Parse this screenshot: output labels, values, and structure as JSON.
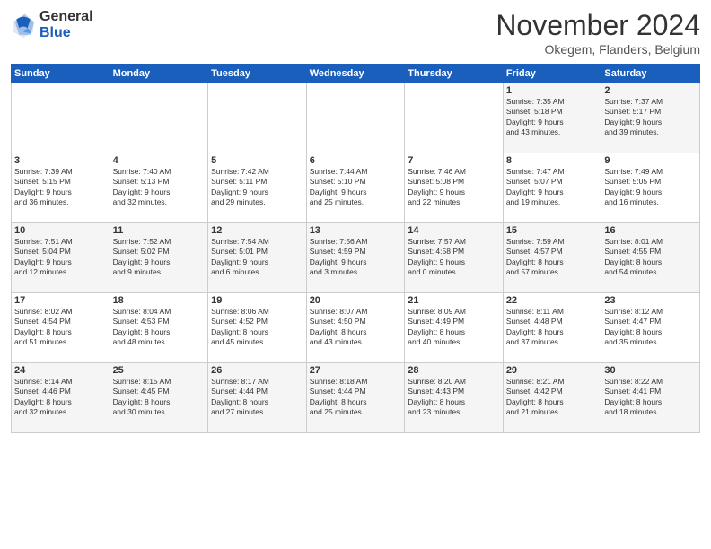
{
  "header": {
    "logo_general": "General",
    "logo_blue": "Blue",
    "title": "November 2024",
    "location": "Okegem, Flanders, Belgium"
  },
  "days_of_week": [
    "Sunday",
    "Monday",
    "Tuesday",
    "Wednesday",
    "Thursday",
    "Friday",
    "Saturday"
  ],
  "weeks": [
    [
      {
        "day": "",
        "info": ""
      },
      {
        "day": "",
        "info": ""
      },
      {
        "day": "",
        "info": ""
      },
      {
        "day": "",
        "info": ""
      },
      {
        "day": "",
        "info": ""
      },
      {
        "day": "1",
        "info": "Sunrise: 7:35 AM\nSunset: 5:18 PM\nDaylight: 9 hours\nand 43 minutes."
      },
      {
        "day": "2",
        "info": "Sunrise: 7:37 AM\nSunset: 5:17 PM\nDaylight: 9 hours\nand 39 minutes."
      }
    ],
    [
      {
        "day": "3",
        "info": "Sunrise: 7:39 AM\nSunset: 5:15 PM\nDaylight: 9 hours\nand 36 minutes."
      },
      {
        "day": "4",
        "info": "Sunrise: 7:40 AM\nSunset: 5:13 PM\nDaylight: 9 hours\nand 32 minutes."
      },
      {
        "day": "5",
        "info": "Sunrise: 7:42 AM\nSunset: 5:11 PM\nDaylight: 9 hours\nand 29 minutes."
      },
      {
        "day": "6",
        "info": "Sunrise: 7:44 AM\nSunset: 5:10 PM\nDaylight: 9 hours\nand 25 minutes."
      },
      {
        "day": "7",
        "info": "Sunrise: 7:46 AM\nSunset: 5:08 PM\nDaylight: 9 hours\nand 22 minutes."
      },
      {
        "day": "8",
        "info": "Sunrise: 7:47 AM\nSunset: 5:07 PM\nDaylight: 9 hours\nand 19 minutes."
      },
      {
        "day": "9",
        "info": "Sunrise: 7:49 AM\nSunset: 5:05 PM\nDaylight: 9 hours\nand 16 minutes."
      }
    ],
    [
      {
        "day": "10",
        "info": "Sunrise: 7:51 AM\nSunset: 5:04 PM\nDaylight: 9 hours\nand 12 minutes."
      },
      {
        "day": "11",
        "info": "Sunrise: 7:52 AM\nSunset: 5:02 PM\nDaylight: 9 hours\nand 9 minutes."
      },
      {
        "day": "12",
        "info": "Sunrise: 7:54 AM\nSunset: 5:01 PM\nDaylight: 9 hours\nand 6 minutes."
      },
      {
        "day": "13",
        "info": "Sunrise: 7:56 AM\nSunset: 4:59 PM\nDaylight: 9 hours\nand 3 minutes."
      },
      {
        "day": "14",
        "info": "Sunrise: 7:57 AM\nSunset: 4:58 PM\nDaylight: 9 hours\nand 0 minutes."
      },
      {
        "day": "15",
        "info": "Sunrise: 7:59 AM\nSunset: 4:57 PM\nDaylight: 8 hours\nand 57 minutes."
      },
      {
        "day": "16",
        "info": "Sunrise: 8:01 AM\nSunset: 4:55 PM\nDaylight: 8 hours\nand 54 minutes."
      }
    ],
    [
      {
        "day": "17",
        "info": "Sunrise: 8:02 AM\nSunset: 4:54 PM\nDaylight: 8 hours\nand 51 minutes."
      },
      {
        "day": "18",
        "info": "Sunrise: 8:04 AM\nSunset: 4:53 PM\nDaylight: 8 hours\nand 48 minutes."
      },
      {
        "day": "19",
        "info": "Sunrise: 8:06 AM\nSunset: 4:52 PM\nDaylight: 8 hours\nand 45 minutes."
      },
      {
        "day": "20",
        "info": "Sunrise: 8:07 AM\nSunset: 4:50 PM\nDaylight: 8 hours\nand 43 minutes."
      },
      {
        "day": "21",
        "info": "Sunrise: 8:09 AM\nSunset: 4:49 PM\nDaylight: 8 hours\nand 40 minutes."
      },
      {
        "day": "22",
        "info": "Sunrise: 8:11 AM\nSunset: 4:48 PM\nDaylight: 8 hours\nand 37 minutes."
      },
      {
        "day": "23",
        "info": "Sunrise: 8:12 AM\nSunset: 4:47 PM\nDaylight: 8 hours\nand 35 minutes."
      }
    ],
    [
      {
        "day": "24",
        "info": "Sunrise: 8:14 AM\nSunset: 4:46 PM\nDaylight: 8 hours\nand 32 minutes."
      },
      {
        "day": "25",
        "info": "Sunrise: 8:15 AM\nSunset: 4:45 PM\nDaylight: 8 hours\nand 30 minutes."
      },
      {
        "day": "26",
        "info": "Sunrise: 8:17 AM\nSunset: 4:44 PM\nDaylight: 8 hours\nand 27 minutes."
      },
      {
        "day": "27",
        "info": "Sunrise: 8:18 AM\nSunset: 4:44 PM\nDaylight: 8 hours\nand 25 minutes."
      },
      {
        "day": "28",
        "info": "Sunrise: 8:20 AM\nSunset: 4:43 PM\nDaylight: 8 hours\nand 23 minutes."
      },
      {
        "day": "29",
        "info": "Sunrise: 8:21 AM\nSunset: 4:42 PM\nDaylight: 8 hours\nand 21 minutes."
      },
      {
        "day": "30",
        "info": "Sunrise: 8:22 AM\nSunset: 4:41 PM\nDaylight: 8 hours\nand 18 minutes."
      }
    ]
  ]
}
